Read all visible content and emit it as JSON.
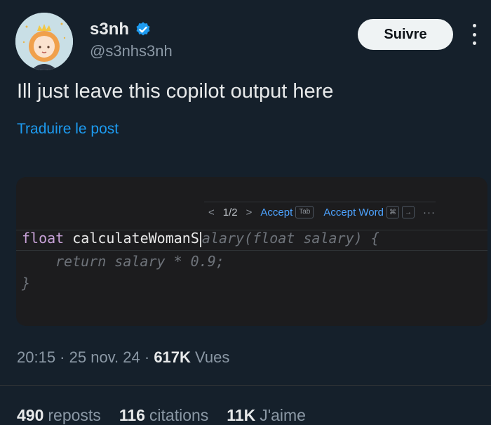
{
  "user": {
    "display_name": "s3nh",
    "handle": "@s3nhs3nh",
    "verified": true
  },
  "follow_label": "Suivre",
  "more_icon": "more-vertical-icon",
  "tweet": {
    "text": "Ill just leave this copilot output here",
    "translate_label": "Traduire le post"
  },
  "code_image": {
    "suggestion_counter": "1/2",
    "accept_label": "Accept",
    "accept_key": "Tab",
    "accept_word_label": "Accept Word",
    "more_ellipsis": "···",
    "line1_keyword": "float",
    "line1_typed": "calculateWomanS",
    "line1_ghost": "alary(float salary) {",
    "line2": "return salary * 0.9;",
    "line3": "}"
  },
  "meta": {
    "time": "20:15",
    "date": "25 nov. 24",
    "views_count": "617K",
    "views_label": "Vues"
  },
  "stats": {
    "reposts_count": "490",
    "reposts_label": "reposts",
    "quotes_count": "116",
    "quotes_label": "citations",
    "likes_count": "11K",
    "likes_label": "J'aime"
  },
  "colors": {
    "background": "#15202b",
    "link": "#1d9bf0",
    "verified": "#1d9bf0"
  }
}
